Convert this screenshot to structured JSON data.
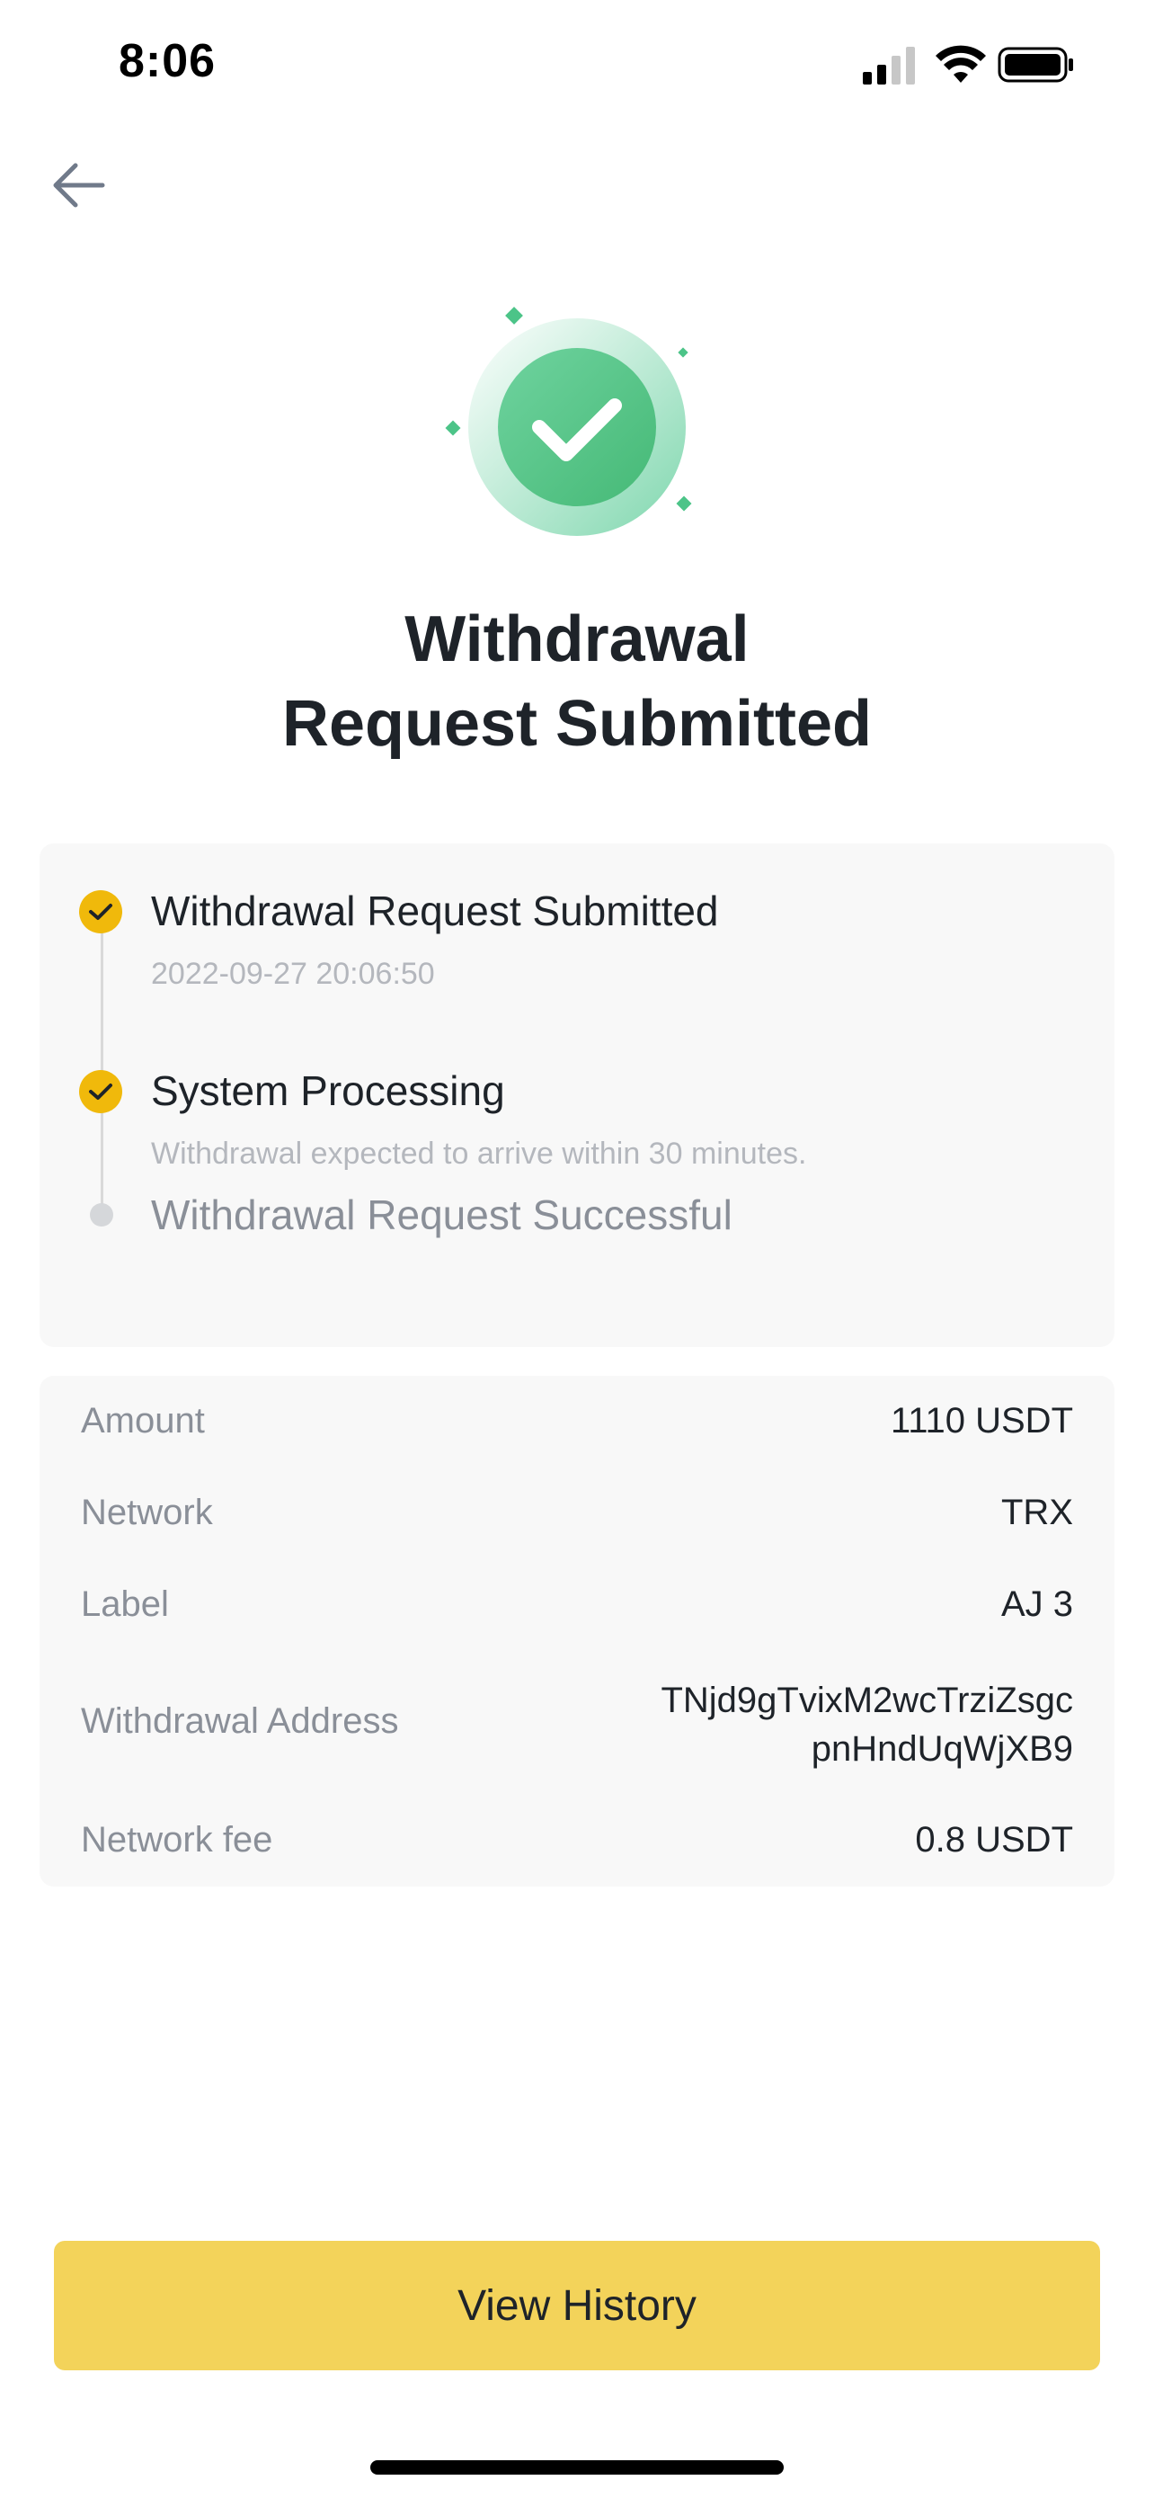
{
  "status_bar": {
    "time": "8:06"
  },
  "title": {
    "line1": "Withdrawal",
    "line2": "Request Submitted"
  },
  "progress": {
    "steps": [
      {
        "title": "Withdrawal Request Submitted",
        "subtitle": "2022-09-27 20:06:50",
        "status": "done"
      },
      {
        "title": "System Processing",
        "subtitle": "Withdrawal expected to arrive within 30 minutes.",
        "status": "done"
      },
      {
        "title": "Withdrawal Request Successful",
        "status": "pending"
      }
    ]
  },
  "details": {
    "amount": {
      "label": "Amount",
      "value": "1110 USDT"
    },
    "network": {
      "label": "Network",
      "value": "TRX"
    },
    "label": {
      "label": "Label",
      "value": "AJ 3"
    },
    "address": {
      "label": "Withdrawal Address",
      "value_line1": "TNjd9gTvixM2wcTrziZsgc",
      "value_line2": "pnHndUqWjXB9"
    },
    "fee": {
      "label": "Network fee",
      "value": "0.8 USDT"
    }
  },
  "buttons": {
    "view_history": "View History"
  },
  "colors": {
    "accent": "#F0B90B",
    "button": "#F3D35A",
    "success": "#2EBD85"
  }
}
